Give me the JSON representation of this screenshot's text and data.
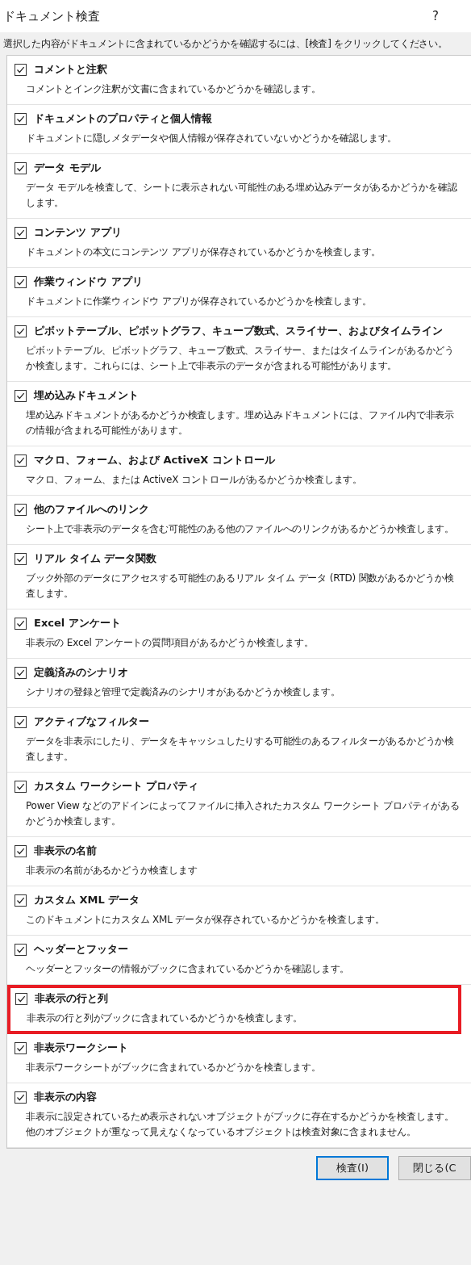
{
  "window": {
    "title": "ドキュメント検査",
    "help": "?"
  },
  "instruction": "選択した内容がドキュメントに含まれているかどうかを確認するには、[検査] をクリックしてください。",
  "items": [
    {
      "title": "コメントと注釈",
      "description": "コメントとインク注釈が文書に含まれているかどうかを確認します。",
      "checked": true,
      "highlighted": false
    },
    {
      "title": "ドキュメントのプロパティと個人情報",
      "description": "ドキュメントに隠しメタデータや個人情報が保存されていないかどうかを確認します。",
      "checked": true,
      "highlighted": false
    },
    {
      "title": "データ モデル",
      "description": "データ モデルを検査して、シートに表示されない可能性のある埋め込みデータがあるかどうかを確認します。",
      "checked": true,
      "highlighted": false
    },
    {
      "title": "コンテンツ アプリ",
      "description": "ドキュメントの本文にコンテンツ アプリが保存されているかどうかを検査します。",
      "checked": true,
      "highlighted": false
    },
    {
      "title": "作業ウィンドウ アプリ",
      "description": "ドキュメントに作業ウィンドウ アプリが保存されているかどうかを検査します。",
      "checked": true,
      "highlighted": false
    },
    {
      "title": "ピボットテーブル、ピボットグラフ、キューブ数式、スライサー、およびタイムライン",
      "description": "ピボットテーブル、ピボットグラフ、キューブ数式、スライサー、またはタイムラインがあるかどうか検査します。これらには、シート上で非表示のデータが含まれる可能性があります。",
      "checked": true,
      "highlighted": false
    },
    {
      "title": "埋め込みドキュメント",
      "description": "埋め込みドキュメントがあるかどうか検査します。埋め込みドキュメントには、ファイル内で非表示の情報が含まれる可能性があります。",
      "checked": true,
      "highlighted": false
    },
    {
      "title": "マクロ、フォーム、および ActiveX コントロール",
      "description": "マクロ、フォーム、または ActiveX コントロールがあるかどうか検査します。",
      "checked": true,
      "highlighted": false
    },
    {
      "title": "他のファイルへのリンク",
      "description": "シート上で非表示のデータを含む可能性のある他のファイルへのリンクがあるかどうか検査します。",
      "checked": true,
      "highlighted": false
    },
    {
      "title": "リアル タイム データ関数",
      "description": "ブック外部のデータにアクセスする可能性のあるリアル タイム データ (RTD) 関数があるかどうか検査します。",
      "checked": true,
      "highlighted": false
    },
    {
      "title": "Excel アンケート",
      "description": "非表示の Excel アンケートの質問項目があるかどうか検査します。",
      "checked": true,
      "highlighted": false
    },
    {
      "title": "定義済みのシナリオ",
      "description": "シナリオの登録と管理で定義済みのシナリオがあるかどうか検査します。",
      "checked": true,
      "highlighted": false
    },
    {
      "title": "アクティブなフィルター",
      "description": "データを非表示にしたり、データをキャッシュしたりする可能性のあるフィルターがあるかどうか検査します。",
      "checked": true,
      "highlighted": false
    },
    {
      "title": "カスタム ワークシート プロパティ",
      "description": "Power View などのアドインによってファイルに挿入されたカスタム ワークシート プロパティがあるかどうか検査します。",
      "checked": true,
      "highlighted": false
    },
    {
      "title": "非表示の名前",
      "description": "非表示の名前があるかどうか検査します",
      "checked": true,
      "highlighted": false
    },
    {
      "title": "カスタム XML データ",
      "description": "このドキュメントにカスタム XML データが保存されているかどうかを検査します。",
      "checked": true,
      "highlighted": false
    },
    {
      "title": "ヘッダーとフッター",
      "description": "ヘッダーとフッターの情報がブックに含まれているかどうかを確認します。",
      "checked": true,
      "highlighted": false
    },
    {
      "title": "非表示の行と列",
      "description": "非表示の行と列がブックに含まれているかどうかを検査します。",
      "checked": true,
      "highlighted": true
    },
    {
      "title": "非表示ワークシート",
      "description": "非表示ワークシートがブックに含まれているかどうかを検査します。",
      "checked": true,
      "highlighted": false
    },
    {
      "title": "非表示の内容",
      "description": "非表示に設定されているため表示されないオブジェクトがブックに存在するかどうかを検査します。他のオブジェクトが重なって見えなくなっているオブジェクトは検査対象に含まれません。",
      "checked": true,
      "highlighted": false
    }
  ],
  "buttons": [
    {
      "label": "検査(I)",
      "default": true
    },
    {
      "label": "閉じる(C",
      "default": false
    }
  ]
}
